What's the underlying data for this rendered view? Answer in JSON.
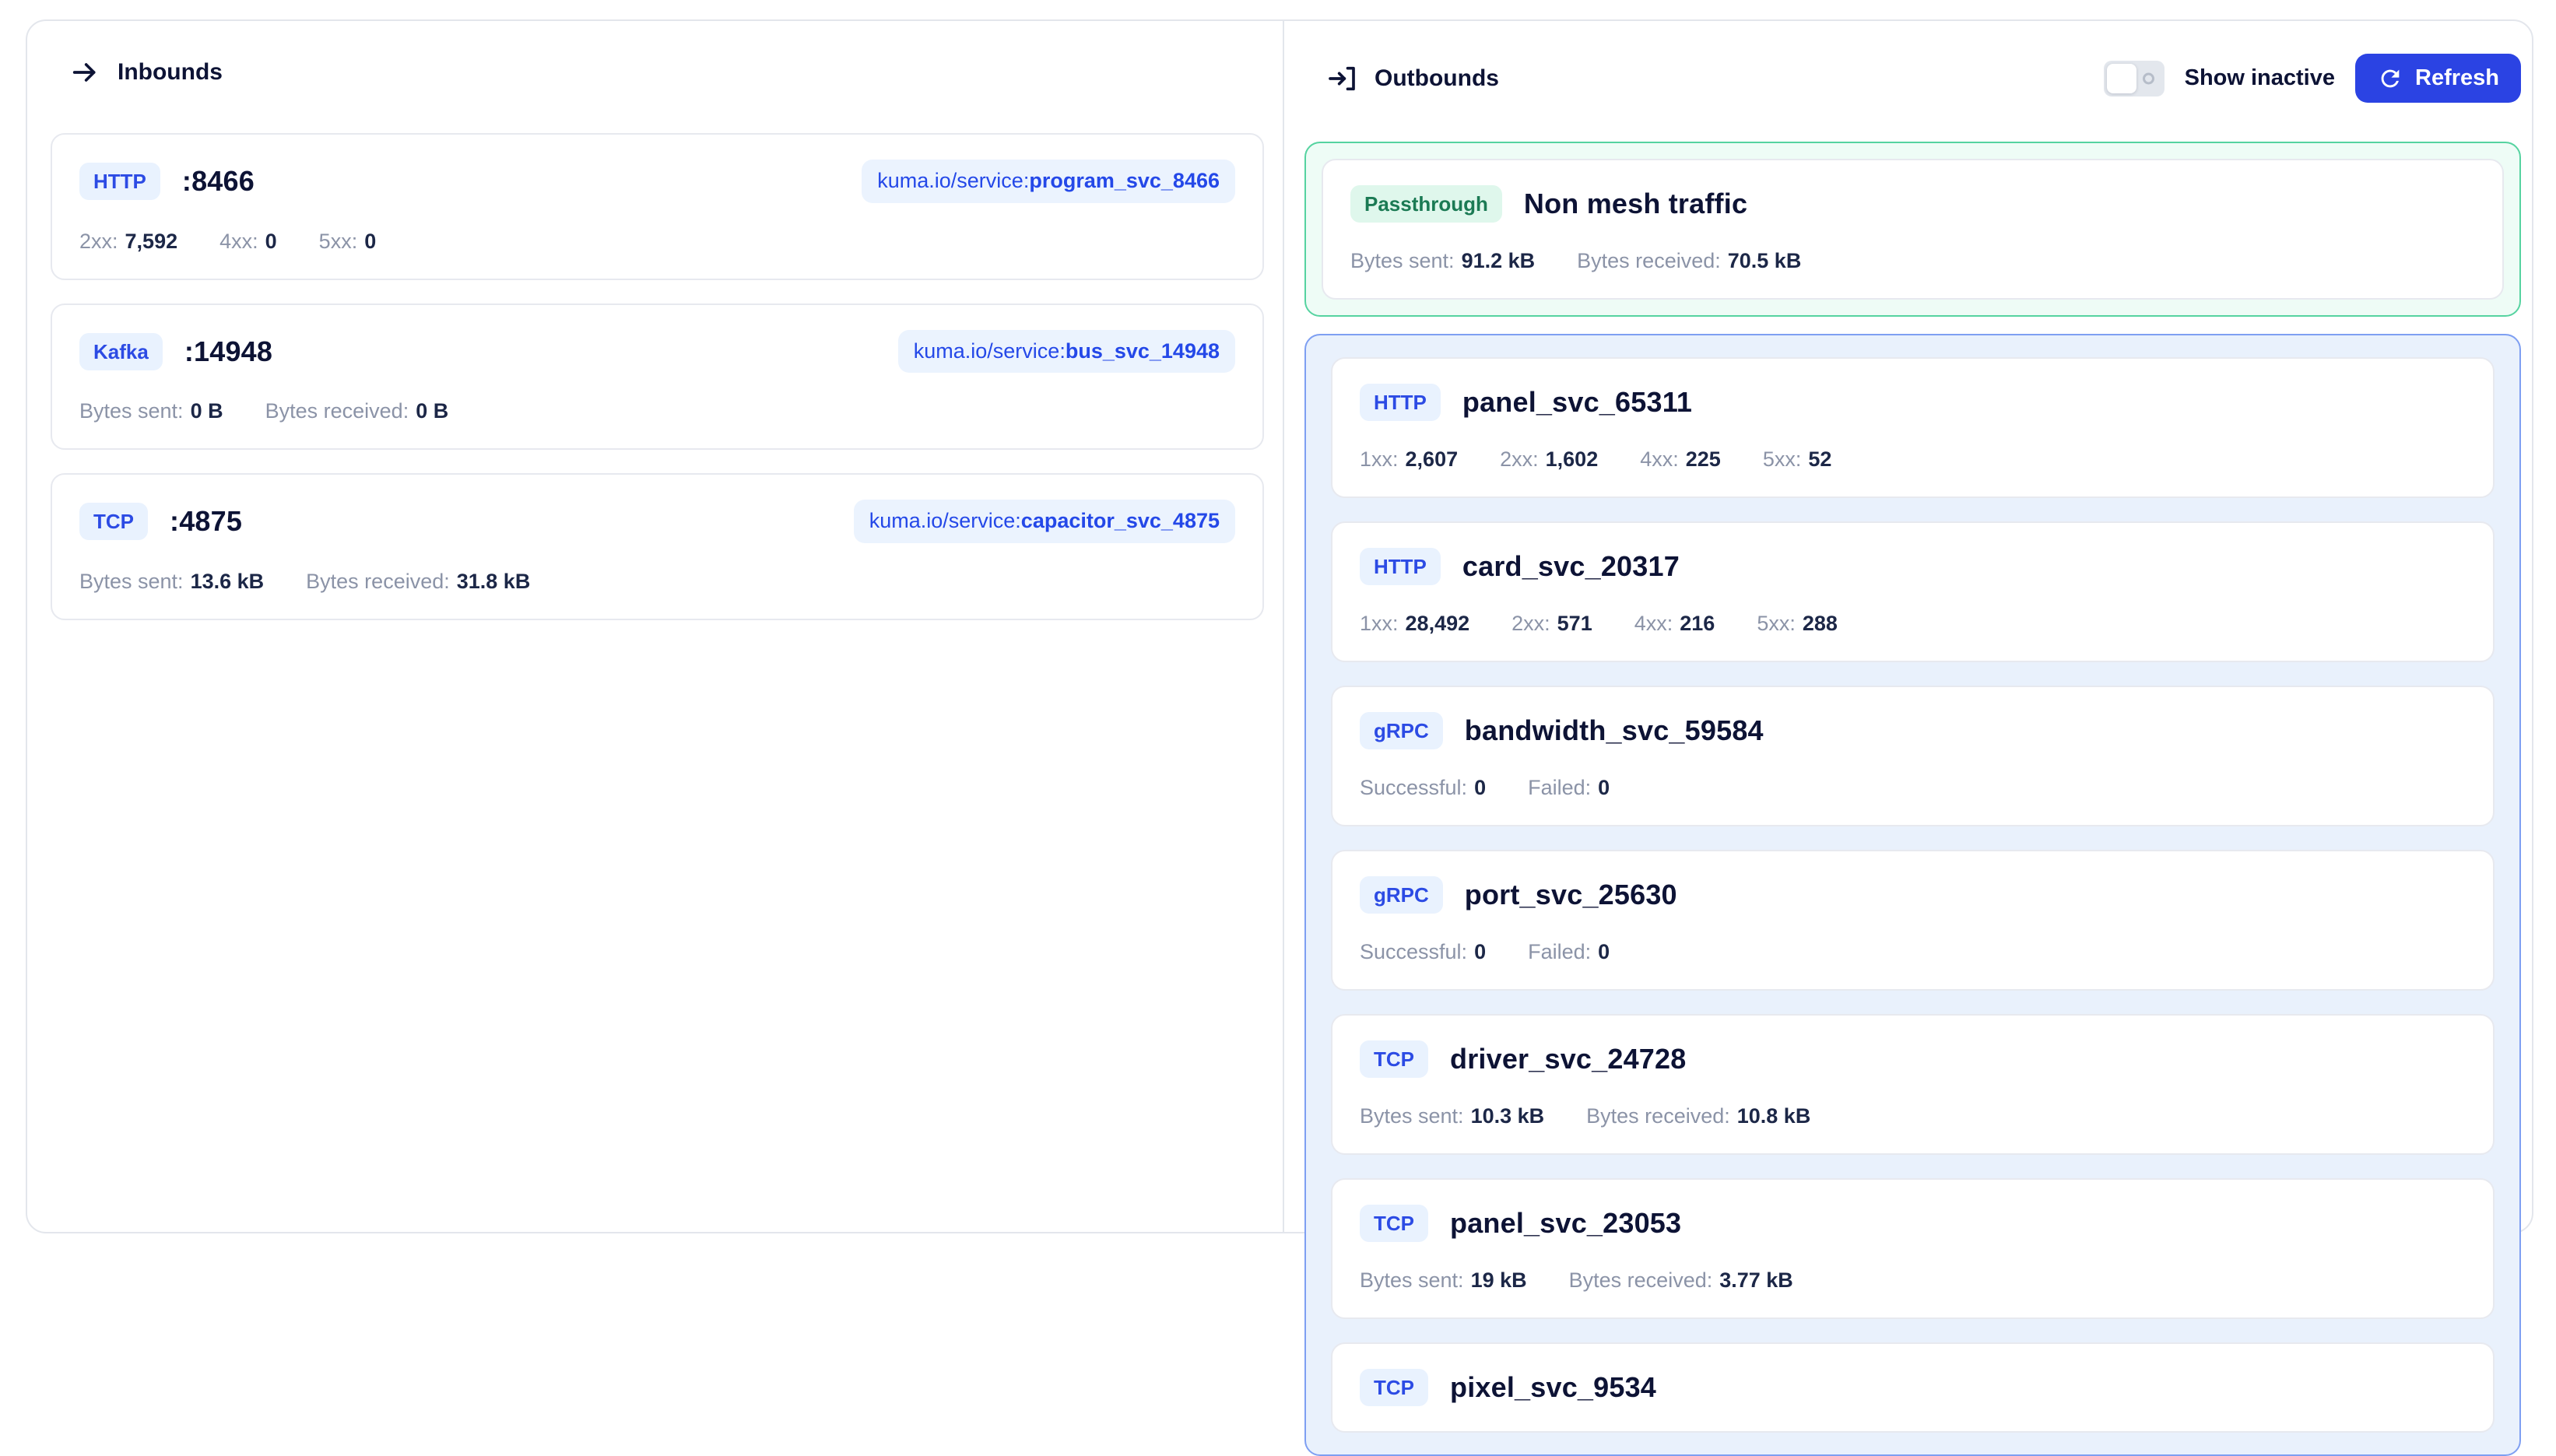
{
  "colors": {
    "accent_blue": "#2b43e3",
    "protocol_badge_bg": "#e9f2fe",
    "protocol_badge_text": "#2c4be4",
    "service_tag_bg": "#ebf3fe",
    "service_tag_text": "#2448e8",
    "passthrough_border": "#55d3a0",
    "passthrough_bg": "#eefcf6",
    "passthrough_badge_bg": "#dff7ec",
    "passthrough_badge_text": "#1b7a54",
    "outbound_container_border": "#7e9ff2",
    "outbound_container_bg": "#e9f1fc",
    "card_border": "#e7e9ef",
    "text_dark": "#0d1335",
    "text_muted": "#8b93a7"
  },
  "icons": {
    "inbounds": "arrow-right-icon",
    "outbounds": "arrow-enter-icon",
    "refresh": "refresh-icon",
    "toggle_state": "off"
  },
  "inbounds": {
    "title": "Inbounds",
    "cards": [
      {
        "protocol": "HTTP",
        "title": ":8466",
        "tag_prefix": "kuma.io/service:",
        "tag_value": "program_svc_8466",
        "stats": [
          {
            "label": "2xx:",
            "value": "7,592"
          },
          {
            "label": "4xx:",
            "value": "0"
          },
          {
            "label": "5xx:",
            "value": "0"
          }
        ]
      },
      {
        "protocol": "Kafka",
        "title": ":14948",
        "tag_prefix": "kuma.io/service:",
        "tag_value": "bus_svc_14948",
        "stats": [
          {
            "label": "Bytes sent:",
            "value": "0 B"
          },
          {
            "label": "Bytes received:",
            "value": "0 B"
          }
        ]
      },
      {
        "protocol": "TCP",
        "title": ":4875",
        "tag_prefix": "kuma.io/service:",
        "tag_value": "capacitor_svc_4875",
        "stats": [
          {
            "label": "Bytes sent:",
            "value": "13.6 kB"
          },
          {
            "label": "Bytes received:",
            "value": "31.8 kB"
          }
        ]
      }
    ]
  },
  "outbounds": {
    "title": "Outbounds",
    "show_inactive_label": "Show inactive",
    "refresh_label": "Refresh",
    "passthrough": {
      "badge": "Passthrough",
      "title": "Non mesh traffic",
      "stats": [
        {
          "label": "Bytes sent:",
          "value": "91.2 kB"
        },
        {
          "label": "Bytes received:",
          "value": "70.5 kB"
        }
      ]
    },
    "cards": [
      {
        "protocol": "HTTP",
        "title": "panel_svc_65311",
        "stats": [
          {
            "label": "1xx:",
            "value": "2,607"
          },
          {
            "label": "2xx:",
            "value": "1,602"
          },
          {
            "label": "4xx:",
            "value": "225"
          },
          {
            "label": "5xx:",
            "value": "52"
          }
        ]
      },
      {
        "protocol": "HTTP",
        "title": "card_svc_20317",
        "stats": [
          {
            "label": "1xx:",
            "value": "28,492"
          },
          {
            "label": "2xx:",
            "value": "571"
          },
          {
            "label": "4xx:",
            "value": "216"
          },
          {
            "label": "5xx:",
            "value": "288"
          }
        ]
      },
      {
        "protocol": "gRPC",
        "title": "bandwidth_svc_59584",
        "stats": [
          {
            "label": "Successful:",
            "value": "0"
          },
          {
            "label": "Failed:",
            "value": "0"
          }
        ]
      },
      {
        "protocol": "gRPC",
        "title": "port_svc_25630",
        "stats": [
          {
            "label": "Successful:",
            "value": "0"
          },
          {
            "label": "Failed:",
            "value": "0"
          }
        ]
      },
      {
        "protocol": "TCP",
        "title": "driver_svc_24728",
        "stats": [
          {
            "label": "Bytes sent:",
            "value": "10.3 kB"
          },
          {
            "label": "Bytes received:",
            "value": "10.8 kB"
          }
        ]
      },
      {
        "protocol": "TCP",
        "title": "panel_svc_23053",
        "stats": [
          {
            "label": "Bytes sent:",
            "value": "19 kB"
          },
          {
            "label": "Bytes received:",
            "value": "3.77 kB"
          }
        ]
      },
      {
        "protocol": "TCP",
        "title": "pixel_svc_9534",
        "stats": []
      }
    ]
  }
}
